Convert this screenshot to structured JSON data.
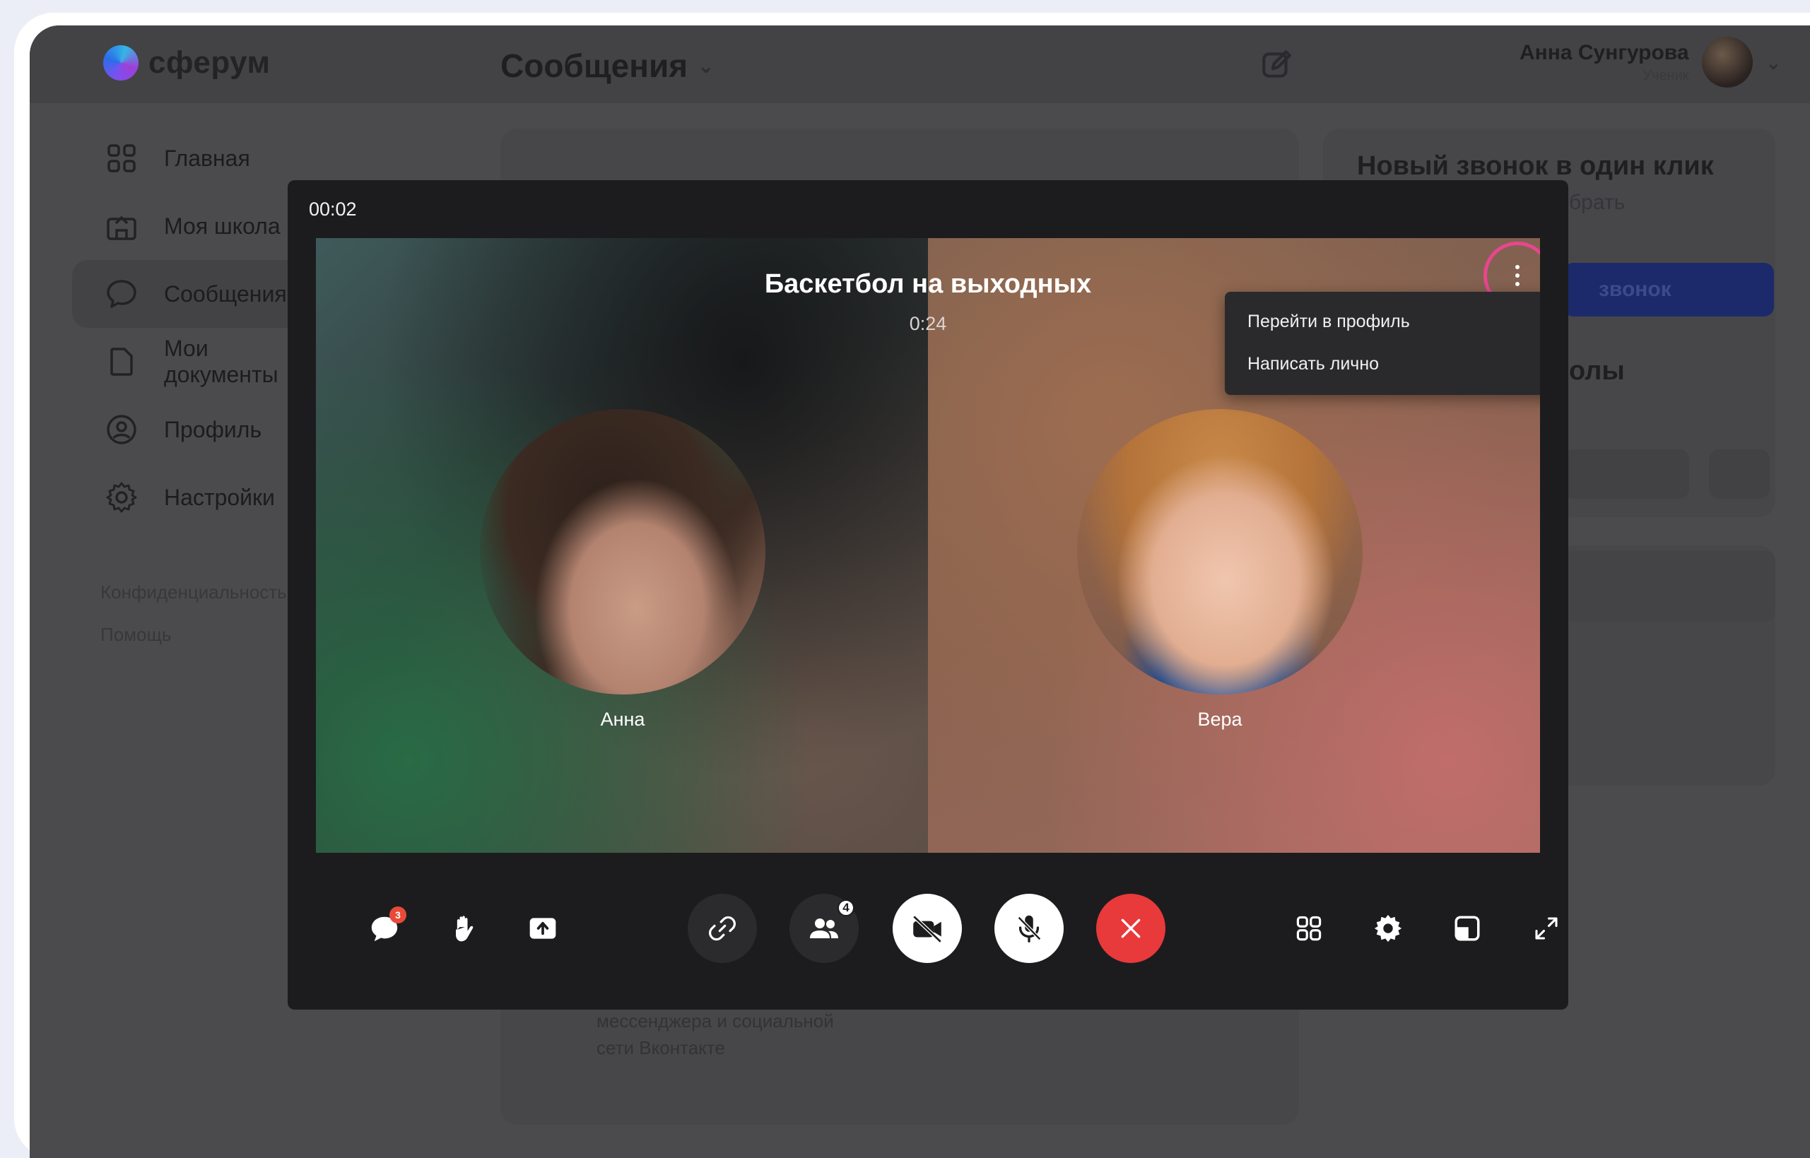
{
  "app": {
    "logo_text": "сферум",
    "section_title": "Сообщения",
    "user": {
      "name": "Анна Сунгурова",
      "role": "Ученик"
    }
  },
  "sidebar": {
    "items": [
      {
        "label": "Главная",
        "icon": "grid-icon"
      },
      {
        "label": "Моя школа",
        "icon": "school-icon"
      },
      {
        "label": "Сообщения",
        "icon": "chat-icon"
      },
      {
        "label": "Мои документы",
        "icon": "document-icon"
      },
      {
        "label": "Профиль",
        "icon": "profile-icon"
      },
      {
        "label": "Настройки",
        "icon": "settings-icon"
      }
    ],
    "links": [
      "Конфиденциальность",
      "Помощь"
    ]
  },
  "background": {
    "new_call_title": "Новый звонок в один клик",
    "new_call_sub": "брать",
    "new_call_button": "звонок",
    "school_heading": "олы",
    "messenger_text_line1": "мессенджера и социальной",
    "messenger_text_line2": "сети Вконтакте"
  },
  "call": {
    "elapsed": "00:02",
    "title": "Баскетбол на выходных",
    "duration": "0:24",
    "participants": [
      {
        "name": "Анна"
      },
      {
        "name": "Вера"
      }
    ],
    "menu": {
      "items": [
        "Перейти в профиль",
        "Написать лично"
      ]
    },
    "toolbar": {
      "chat_badge": "3",
      "participants_count": "4",
      "colors": {
        "end_call": "#e8393b",
        "highlight": "#e8468f"
      }
    }
  }
}
